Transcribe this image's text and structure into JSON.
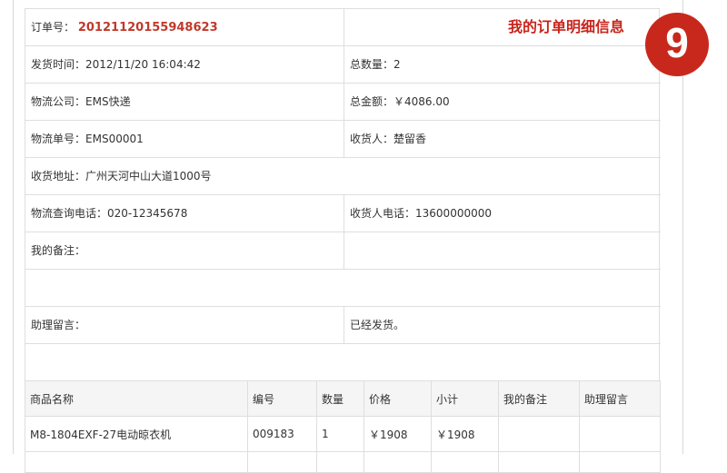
{
  "order": {
    "no_label": "订单号：",
    "no_value": "20121120155948623",
    "page_title": "我的订单明细信息",
    "step": "9"
  },
  "info": {
    "ship_time_label": "发货时间：",
    "ship_time_value": "2012/11/20 16:04:42",
    "total_qty_label": "总数量：",
    "total_qty_value": "2",
    "carrier_label": "物流公司：",
    "carrier_value": "EMS快递",
    "total_amount_label": "总金额：",
    "total_amount_value": "￥4086.00",
    "tracking_label": "物流单号：",
    "tracking_value": "EMS00001",
    "receiver_label": "收货人：",
    "receiver_value": "楚留香",
    "address_label": "收货地址：",
    "address_value": "广州天河中山大道1000号",
    "carrier_phone_label": "物流查询电话：",
    "carrier_phone_value": "020-12345678",
    "receiver_phone_label": "收货人电话：",
    "receiver_phone_value": "13600000000",
    "my_note_label": "我的备注：",
    "my_note_value": "",
    "assistant_label": "助理留言：",
    "assistant_value": "已经发货。"
  },
  "items": {
    "headers": [
      "商品名称",
      "编号",
      "数量",
      "价格",
      "小计",
      "我的备注",
      "助理留言"
    ],
    "rows": [
      [
        "M8-1804EXF-27电动晾衣机",
        "009183",
        "1",
        "￥1908",
        "￥1908",
        "",
        ""
      ]
    ]
  },
  "colors": {
    "accent_red": "#c8241b",
    "border": "#dedede"
  }
}
